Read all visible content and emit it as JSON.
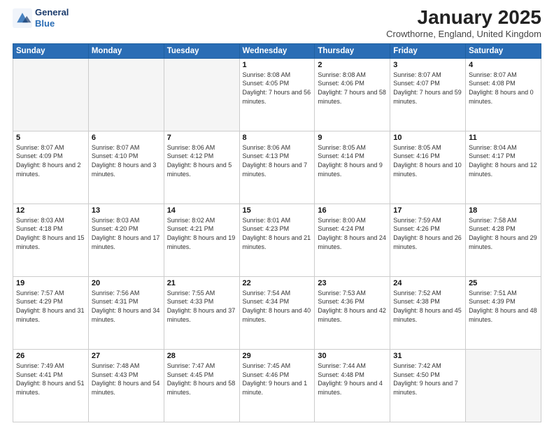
{
  "header": {
    "logo_line1": "General",
    "logo_line2": "Blue",
    "month": "January 2025",
    "location": "Crowthorne, England, United Kingdom"
  },
  "weekdays": [
    "Sunday",
    "Monday",
    "Tuesday",
    "Wednesday",
    "Thursday",
    "Friday",
    "Saturday"
  ],
  "weeks": [
    [
      {
        "day": "",
        "sunrise": "",
        "sunset": "",
        "daylight": "",
        "empty": true
      },
      {
        "day": "",
        "sunrise": "",
        "sunset": "",
        "daylight": "",
        "empty": true
      },
      {
        "day": "",
        "sunrise": "",
        "sunset": "",
        "daylight": "",
        "empty": true
      },
      {
        "day": "1",
        "sunrise": "Sunrise: 8:08 AM",
        "sunset": "Sunset: 4:05 PM",
        "daylight": "Daylight: 7 hours and 56 minutes.",
        "empty": false
      },
      {
        "day": "2",
        "sunrise": "Sunrise: 8:08 AM",
        "sunset": "Sunset: 4:06 PM",
        "daylight": "Daylight: 7 hours and 58 minutes.",
        "empty": false
      },
      {
        "day": "3",
        "sunrise": "Sunrise: 8:07 AM",
        "sunset": "Sunset: 4:07 PM",
        "daylight": "Daylight: 7 hours and 59 minutes.",
        "empty": false
      },
      {
        "day": "4",
        "sunrise": "Sunrise: 8:07 AM",
        "sunset": "Sunset: 4:08 PM",
        "daylight": "Daylight: 8 hours and 0 minutes.",
        "empty": false
      }
    ],
    [
      {
        "day": "5",
        "sunrise": "Sunrise: 8:07 AM",
        "sunset": "Sunset: 4:09 PM",
        "daylight": "Daylight: 8 hours and 2 minutes.",
        "empty": false
      },
      {
        "day": "6",
        "sunrise": "Sunrise: 8:07 AM",
        "sunset": "Sunset: 4:10 PM",
        "daylight": "Daylight: 8 hours and 3 minutes.",
        "empty": false
      },
      {
        "day": "7",
        "sunrise": "Sunrise: 8:06 AM",
        "sunset": "Sunset: 4:12 PM",
        "daylight": "Daylight: 8 hours and 5 minutes.",
        "empty": false
      },
      {
        "day": "8",
        "sunrise": "Sunrise: 8:06 AM",
        "sunset": "Sunset: 4:13 PM",
        "daylight": "Daylight: 8 hours and 7 minutes.",
        "empty": false
      },
      {
        "day": "9",
        "sunrise": "Sunrise: 8:05 AM",
        "sunset": "Sunset: 4:14 PM",
        "daylight": "Daylight: 8 hours and 9 minutes.",
        "empty": false
      },
      {
        "day": "10",
        "sunrise": "Sunrise: 8:05 AM",
        "sunset": "Sunset: 4:16 PM",
        "daylight": "Daylight: 8 hours and 10 minutes.",
        "empty": false
      },
      {
        "day": "11",
        "sunrise": "Sunrise: 8:04 AM",
        "sunset": "Sunset: 4:17 PM",
        "daylight": "Daylight: 8 hours and 12 minutes.",
        "empty": false
      }
    ],
    [
      {
        "day": "12",
        "sunrise": "Sunrise: 8:03 AM",
        "sunset": "Sunset: 4:18 PM",
        "daylight": "Daylight: 8 hours and 15 minutes.",
        "empty": false
      },
      {
        "day": "13",
        "sunrise": "Sunrise: 8:03 AM",
        "sunset": "Sunset: 4:20 PM",
        "daylight": "Daylight: 8 hours and 17 minutes.",
        "empty": false
      },
      {
        "day": "14",
        "sunrise": "Sunrise: 8:02 AM",
        "sunset": "Sunset: 4:21 PM",
        "daylight": "Daylight: 8 hours and 19 minutes.",
        "empty": false
      },
      {
        "day": "15",
        "sunrise": "Sunrise: 8:01 AM",
        "sunset": "Sunset: 4:23 PM",
        "daylight": "Daylight: 8 hours and 21 minutes.",
        "empty": false
      },
      {
        "day": "16",
        "sunrise": "Sunrise: 8:00 AM",
        "sunset": "Sunset: 4:24 PM",
        "daylight": "Daylight: 8 hours and 24 minutes.",
        "empty": false
      },
      {
        "day": "17",
        "sunrise": "Sunrise: 7:59 AM",
        "sunset": "Sunset: 4:26 PM",
        "daylight": "Daylight: 8 hours and 26 minutes.",
        "empty": false
      },
      {
        "day": "18",
        "sunrise": "Sunrise: 7:58 AM",
        "sunset": "Sunset: 4:28 PM",
        "daylight": "Daylight: 8 hours and 29 minutes.",
        "empty": false
      }
    ],
    [
      {
        "day": "19",
        "sunrise": "Sunrise: 7:57 AM",
        "sunset": "Sunset: 4:29 PM",
        "daylight": "Daylight: 8 hours and 31 minutes.",
        "empty": false
      },
      {
        "day": "20",
        "sunrise": "Sunrise: 7:56 AM",
        "sunset": "Sunset: 4:31 PM",
        "daylight": "Daylight: 8 hours and 34 minutes.",
        "empty": false
      },
      {
        "day": "21",
        "sunrise": "Sunrise: 7:55 AM",
        "sunset": "Sunset: 4:33 PM",
        "daylight": "Daylight: 8 hours and 37 minutes.",
        "empty": false
      },
      {
        "day": "22",
        "sunrise": "Sunrise: 7:54 AM",
        "sunset": "Sunset: 4:34 PM",
        "daylight": "Daylight: 8 hours and 40 minutes.",
        "empty": false
      },
      {
        "day": "23",
        "sunrise": "Sunrise: 7:53 AM",
        "sunset": "Sunset: 4:36 PM",
        "daylight": "Daylight: 8 hours and 42 minutes.",
        "empty": false
      },
      {
        "day": "24",
        "sunrise": "Sunrise: 7:52 AM",
        "sunset": "Sunset: 4:38 PM",
        "daylight": "Daylight: 8 hours and 45 minutes.",
        "empty": false
      },
      {
        "day": "25",
        "sunrise": "Sunrise: 7:51 AM",
        "sunset": "Sunset: 4:39 PM",
        "daylight": "Daylight: 8 hours and 48 minutes.",
        "empty": false
      }
    ],
    [
      {
        "day": "26",
        "sunrise": "Sunrise: 7:49 AM",
        "sunset": "Sunset: 4:41 PM",
        "daylight": "Daylight: 8 hours and 51 minutes.",
        "empty": false
      },
      {
        "day": "27",
        "sunrise": "Sunrise: 7:48 AM",
        "sunset": "Sunset: 4:43 PM",
        "daylight": "Daylight: 8 hours and 54 minutes.",
        "empty": false
      },
      {
        "day": "28",
        "sunrise": "Sunrise: 7:47 AM",
        "sunset": "Sunset: 4:45 PM",
        "daylight": "Daylight: 8 hours and 58 minutes.",
        "empty": false
      },
      {
        "day": "29",
        "sunrise": "Sunrise: 7:45 AM",
        "sunset": "Sunset: 4:46 PM",
        "daylight": "Daylight: 9 hours and 1 minute.",
        "empty": false
      },
      {
        "day": "30",
        "sunrise": "Sunrise: 7:44 AM",
        "sunset": "Sunset: 4:48 PM",
        "daylight": "Daylight: 9 hours and 4 minutes.",
        "empty": false
      },
      {
        "day": "31",
        "sunrise": "Sunrise: 7:42 AM",
        "sunset": "Sunset: 4:50 PM",
        "daylight": "Daylight: 9 hours and 7 minutes.",
        "empty": false
      },
      {
        "day": "",
        "sunrise": "",
        "sunset": "",
        "daylight": "",
        "empty": true
      }
    ]
  ]
}
